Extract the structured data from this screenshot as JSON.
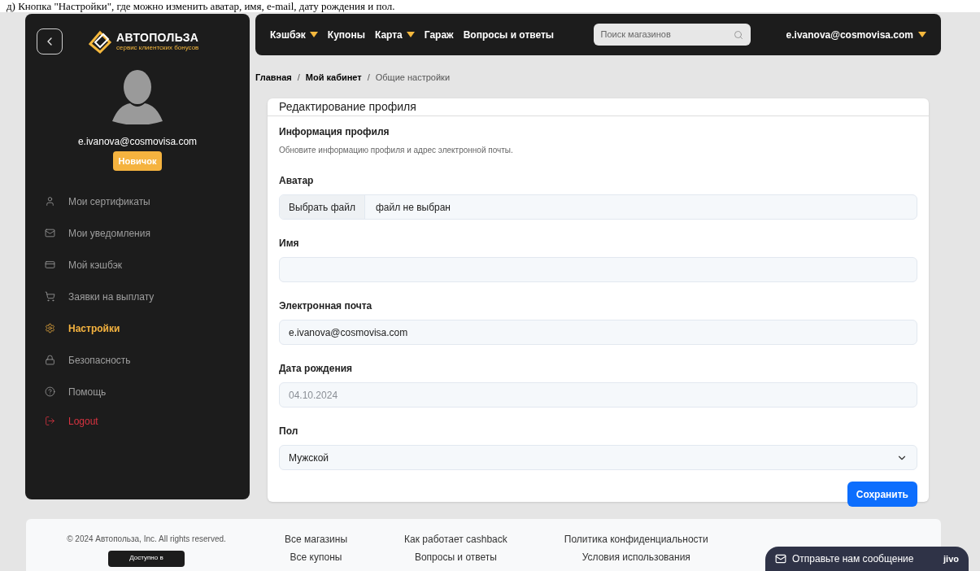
{
  "caption": "д) Кнопка \"Настройки\", где можно изменить аватар, имя, e-mail, дату рождения и пол.",
  "sidebar": {
    "logo": {
      "name": "АВТОПОЛЬЗА",
      "tagline": "сервис клиентских бонусов"
    },
    "user": {
      "email": "e.ivanova@cosmovisa.com",
      "badge": "Новичок"
    },
    "items": [
      {
        "label": "Мои сертификаты",
        "kind": "link",
        "selected": false
      },
      {
        "label": "Мои уведомления",
        "kind": "link",
        "selected": false
      },
      {
        "label": "Мой кэшбэк",
        "kind": "link",
        "selected": false
      },
      {
        "label": "Заявки на выплату",
        "kind": "link",
        "selected": false
      },
      {
        "label": "Настройки",
        "kind": "link",
        "selected": true
      },
      {
        "label": "Безопасность",
        "kind": "link",
        "selected": false
      },
      {
        "label": "Помощь",
        "kind": "link",
        "selected": false
      },
      {
        "label": "Logout",
        "kind": "logout",
        "selected": false
      }
    ]
  },
  "nav": {
    "items": [
      {
        "label": "Кэшбэк",
        "dropdown": true
      },
      {
        "label": "Купоны",
        "dropdown": false
      },
      {
        "label": "Карта",
        "dropdown": true
      },
      {
        "label": "Гараж",
        "dropdown": false
      },
      {
        "label": "Вопросы и ответы",
        "dropdown": false
      }
    ],
    "search": {
      "placeholder": "Поиск магазинов"
    },
    "account": "e.ivanova@cosmovisa.com"
  },
  "breadcrumbs": [
    {
      "label": "Главная",
      "current": false
    },
    {
      "separator": "/",
      "label": "Мой кабинет",
      "current": false
    },
    {
      "separator": "/",
      "label": "Общие настройки",
      "current": true
    }
  ],
  "card": {
    "title": "Редактирование профиля",
    "section": "Информация профиля",
    "description": "Обновите информацию профиля и адрес электронной почты.",
    "fields": [
      {
        "label": "Аватар",
        "kind": "file",
        "button": "Выбрать файл",
        "value": "файл не выбран"
      },
      {
        "label": "Имя",
        "kind": "text"
      },
      {
        "label": "Электронная почта",
        "kind": "text",
        "value": "e.ivanova@cosmovisa.com"
      },
      {
        "label": "Дата рождения",
        "kind": "text",
        "placeholder": "04.10.2024"
      },
      {
        "label": "Пол",
        "kind": "select",
        "value": "Мужской"
      }
    ],
    "submit": "Сохранить"
  },
  "footer": {
    "copyright": "© 2024 Автопольза, Inc. All rights reserved.",
    "app_badge": "Доступно в",
    "columns": [
      [
        "Все магазины",
        "Все купоны"
      ],
      [
        "Как работает cashback",
        "Вопросы и ответы"
      ],
      [
        "Политика конфиденциальности",
        "Условия использования"
      ]
    ]
  },
  "chat": {
    "label": "Отправьте нам сообщение",
    "brand": "jivo"
  }
}
